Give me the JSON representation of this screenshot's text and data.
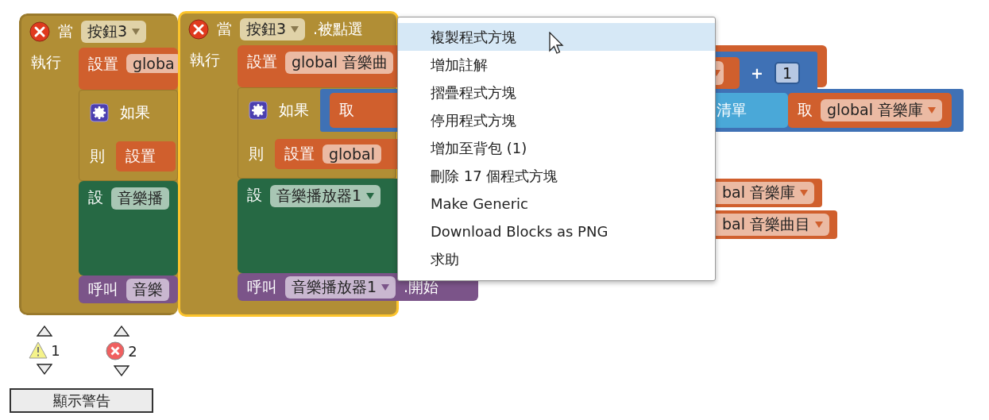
{
  "blocks": [
    {
      "selected": false,
      "when": "當",
      "component": "按鈕3",
      "do": "執行",
      "set": "設置",
      "set_var": "globa",
      "if": "如果",
      "then": "則",
      "then_set": "設置",
      "prop_set": "設",
      "prop_component": "音樂播",
      "call": "呼叫",
      "call_component": "音樂"
    },
    {
      "selected": true,
      "when": "當",
      "component": "按鈕3",
      "event": ".被點選",
      "do": "執行",
      "set": "設置",
      "set_var": "global 音樂曲",
      "plus": "+",
      "number": "1",
      "if": "如果",
      "if_get": "取",
      "list_label": "清單",
      "list_get": "取",
      "list_var": "global 音樂庫",
      "then": "則",
      "then_set": "設置",
      "then_var": "global",
      "prop_set": "設",
      "prop_component": "音樂播放器1",
      "call": "呼叫",
      "call_component": "音樂播放器1",
      "call_method": ".開始"
    }
  ],
  "fragments": [
    {
      "text": "bal 音樂庫"
    },
    {
      "text": "bal 音樂曲目"
    }
  ],
  "context_menu": {
    "items": [
      {
        "label": "複製程式方塊",
        "selected": true
      },
      {
        "label": "增加註解",
        "selected": false
      },
      {
        "label": "摺疊程式方塊",
        "selected": false
      },
      {
        "label": "停用程式方塊",
        "selected": false
      },
      {
        "label": "增加至背包 (1)",
        "selected": false
      },
      {
        "label": "刪除 17 個程式方塊",
        "selected": false
      },
      {
        "label": "Make Generic",
        "selected": false
      },
      {
        "label": "Download Blocks as PNG",
        "selected": false
      },
      {
        "label": "求助",
        "selected": false
      }
    ]
  },
  "warnings": {
    "warning_count": "1",
    "error_count": "2",
    "button": "顯示警告"
  }
}
